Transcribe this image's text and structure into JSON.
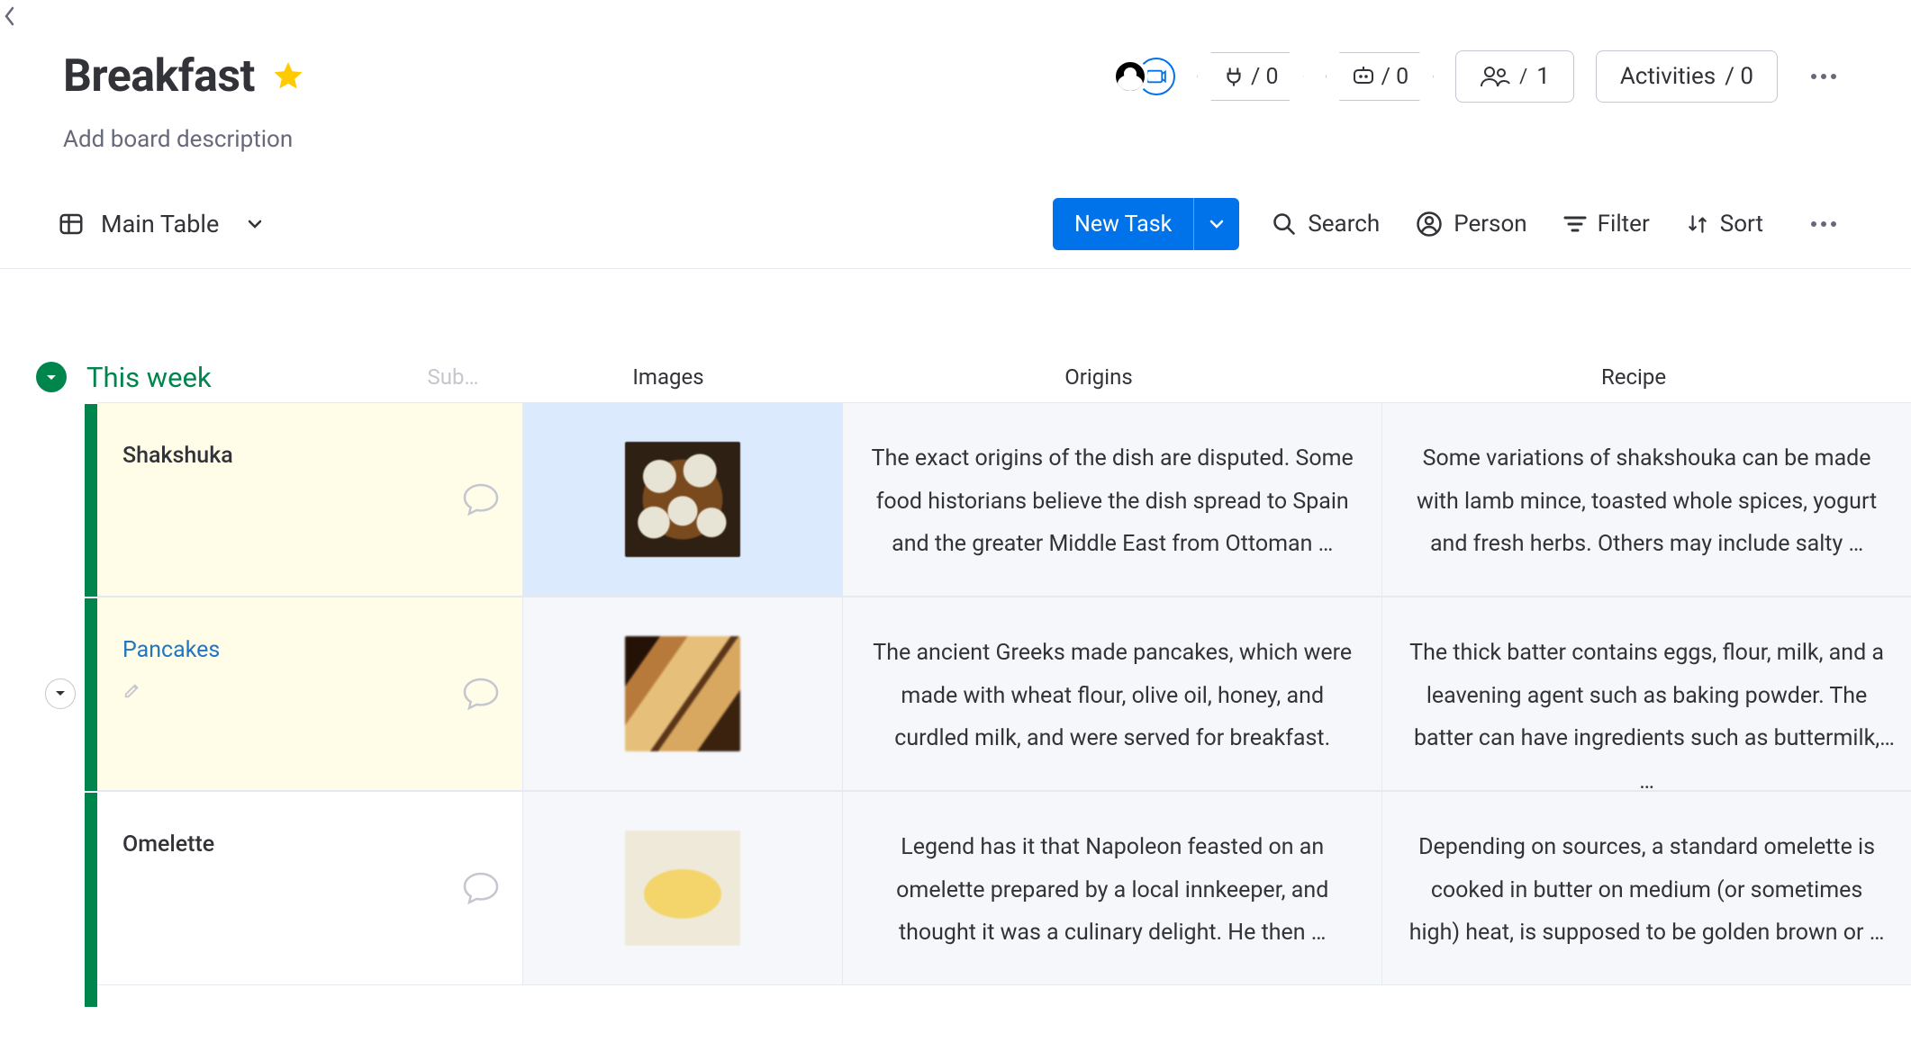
{
  "header": {
    "title": "Breakfast",
    "description_placeholder": "Add board description",
    "integrations_count": "/ 0",
    "automations_count": "/ 0",
    "members_count": "1",
    "activities_label": "Activities",
    "activities_count": "/ 0"
  },
  "toolbar": {
    "view_label": "Main Table",
    "new_task_label": "New Task",
    "search_label": "Search",
    "person_label": "Person",
    "filter_label": "Filter",
    "sort_label": "Sort"
  },
  "group": {
    "title": "This week",
    "columns": {
      "subitems": "Sub…",
      "images": "Images",
      "origins": "Origins",
      "recipe": "Recipe"
    },
    "rows": [
      {
        "name": "Shakshuka",
        "is_link": false,
        "thumb_class": "thumb-shakshuka",
        "image_selected": true,
        "hovered": true,
        "show_handle": false,
        "show_edit": false,
        "origins": "The exact origins of the dish are disputed. Some food historians believe the dish spread to Spain and the greater Middle East from Ottoman …",
        "recipe": "Some variations of shakshouka can be made with lamb mince, toasted whole spices, yogurt and fresh herbs. Others may include salty …"
      },
      {
        "name": "Pancakes",
        "is_link": true,
        "thumb_class": "thumb-pancakes",
        "image_selected": false,
        "hovered": true,
        "show_handle": true,
        "show_edit": true,
        "origins": "The ancient Greeks made pancakes, which were made with wheat flour, olive oil, honey, and curdled milk, and were served for breakfast.",
        "recipe": "The thick batter contains eggs, flour, milk, and a leavening agent such as baking powder. The batter can have ingredients such as buttermilk, …"
      },
      {
        "name": "Omelette",
        "is_link": false,
        "thumb_class": "thumb-omelette",
        "image_selected": false,
        "hovered": false,
        "show_handle": false,
        "show_edit": false,
        "origins": "Legend has it that Napoleon feasted on an omelette prepared by a local innkeeper, and thought it was a culinary delight. He then …",
        "recipe": "Depending on sources, a standard omelette is cooked in butter on medium (or sometimes high) heat, is supposed to be golden brown or …"
      }
    ]
  }
}
